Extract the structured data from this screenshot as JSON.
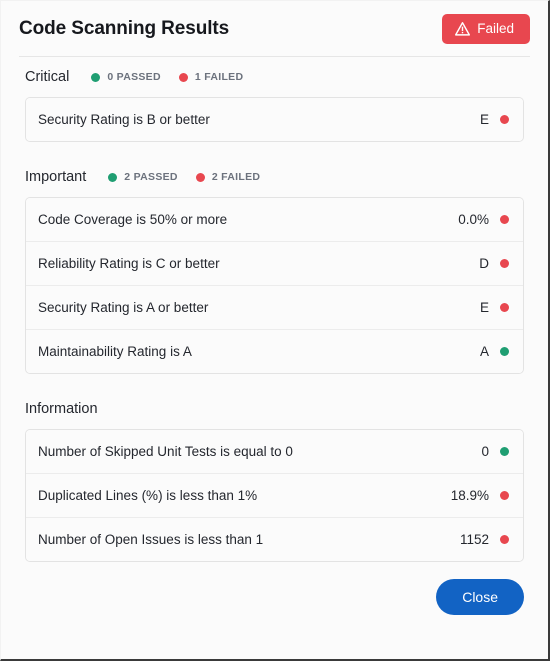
{
  "window": {
    "title": "Code Scanning Results"
  },
  "status_badge": {
    "label": "Failed",
    "icon": "warning-triangle-icon",
    "color": "#e8474f"
  },
  "colors": {
    "pass": "#1f9e72",
    "fail": "#e8474f",
    "accent": "#1263c4",
    "card_border": "#e3e3e3",
    "background": "#fbfbfb"
  },
  "sections": [
    {
      "title": "Critical",
      "counts": [
        {
          "label": "0 PASSED",
          "state": "pass"
        },
        {
          "label": "1 FAILED",
          "state": "fail"
        }
      ],
      "rows": [
        {
          "label": "Security Rating is B or better",
          "value": "E",
          "state": "fail"
        }
      ]
    },
    {
      "title": "Important",
      "counts": [
        {
          "label": "2 PASSED",
          "state": "pass"
        },
        {
          "label": "2 FAILED",
          "state": "fail"
        }
      ],
      "rows": [
        {
          "label": "Code Coverage is 50% or more",
          "value": "0.0%",
          "state": "fail"
        },
        {
          "label": "Reliability Rating is C or better",
          "value": "D",
          "state": "fail"
        },
        {
          "label": "Security Rating is A or better",
          "value": "E",
          "state": "fail"
        },
        {
          "label": "Maintainability Rating is A",
          "value": "A",
          "state": "pass"
        }
      ]
    },
    {
      "title": "Information",
      "counts": [],
      "rows": [
        {
          "label": "Number of Skipped Unit Tests is equal to 0",
          "value": "0",
          "state": "pass"
        },
        {
          "label": "Duplicated Lines (%) is less than 1%",
          "value": "18.9%",
          "state": "fail"
        },
        {
          "label": "Number of Open Issues is less than 1",
          "value": "1152",
          "state": "fail"
        }
      ]
    }
  ],
  "footer": {
    "close_label": "Close"
  }
}
